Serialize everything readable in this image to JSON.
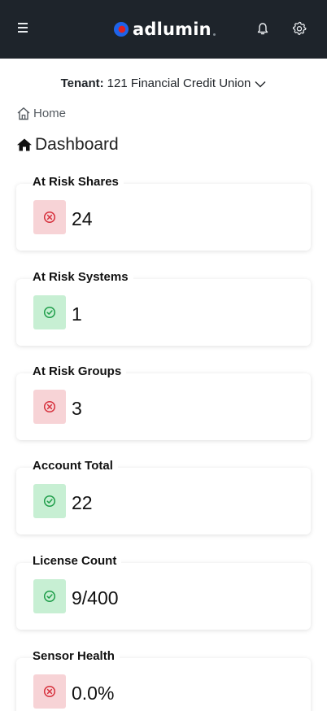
{
  "header": {
    "brand": "adlumin",
    "colors": {
      "bar": "#1e242b",
      "brand_blue": "#1e63e9",
      "brand_red": "#e02020"
    },
    "icons": [
      "hamburger-menu-icon",
      "bell-icon",
      "gear-icon"
    ]
  },
  "tenant": {
    "label": "Tenant:",
    "value": "121 Financial Credit Union"
  },
  "breadcrumb": {
    "home": "Home"
  },
  "page": {
    "title": "Dashboard"
  },
  "metrics": [
    {
      "label": "At Risk Shares",
      "value": "24",
      "status": "bad"
    },
    {
      "label": "At Risk Systems",
      "value": "1",
      "status": "good"
    },
    {
      "label": "At Risk Groups",
      "value": "3",
      "status": "bad"
    },
    {
      "label": "Account Total",
      "value": "22",
      "status": "good"
    },
    {
      "label": "License Count",
      "value": "9/400",
      "status": "good"
    },
    {
      "label": "Sensor Health",
      "value": "0.0%",
      "status": "bad"
    }
  ],
  "status_colors": {
    "bad": "#d6303c",
    "good": "#1f9e4a"
  }
}
